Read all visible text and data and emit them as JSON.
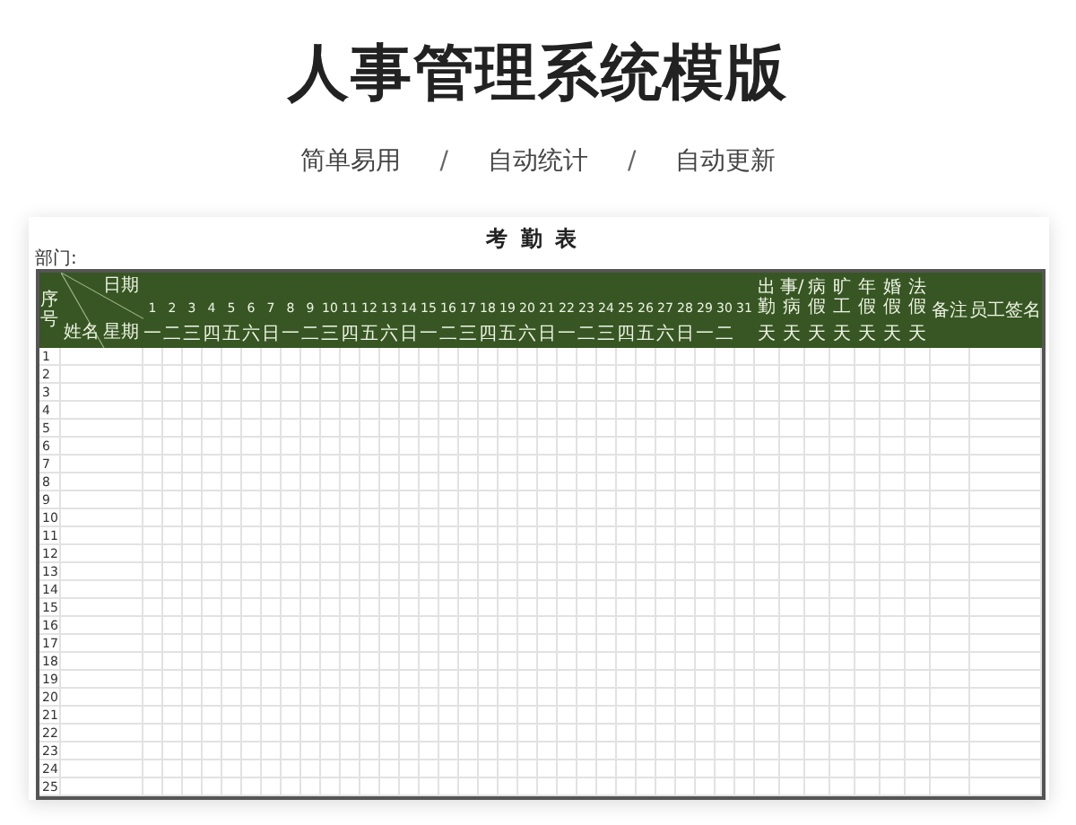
{
  "page_title": "人事管理系统模版",
  "taglines": [
    {
      "kind": "feature",
      "text": "简单易用"
    },
    {
      "kind": "separator",
      "text": "/"
    },
    {
      "kind": "feature",
      "text": "自动统计"
    },
    {
      "kind": "separator",
      "text": "/"
    },
    {
      "kind": "feature",
      "text": "自动更新"
    }
  ],
  "sheet": {
    "title": "考勤表",
    "department_label": "部门:",
    "header": {
      "index": "序号",
      "name": "姓名",
      "date": "日期",
      "weekday": "星期"
    },
    "days": [
      {
        "day": "1",
        "weekday": "一"
      },
      {
        "day": "2",
        "weekday": "二"
      },
      {
        "day": "3",
        "weekday": "三"
      },
      {
        "day": "4",
        "weekday": "四"
      },
      {
        "day": "5",
        "weekday": "五"
      },
      {
        "day": "6",
        "weekday": "六"
      },
      {
        "day": "7",
        "weekday": "日"
      },
      {
        "day": "8",
        "weekday": "一"
      },
      {
        "day": "9",
        "weekday": "二"
      },
      {
        "day": "10",
        "weekday": "三"
      },
      {
        "day": "11",
        "weekday": "四"
      },
      {
        "day": "12",
        "weekday": "五"
      },
      {
        "day": "13",
        "weekday": "六"
      },
      {
        "day": "14",
        "weekday": "日"
      },
      {
        "day": "15",
        "weekday": "一"
      },
      {
        "day": "16",
        "weekday": "二"
      },
      {
        "day": "17",
        "weekday": "三"
      },
      {
        "day": "18",
        "weekday": "四"
      },
      {
        "day": "19",
        "weekday": "五"
      },
      {
        "day": "20",
        "weekday": "六"
      },
      {
        "day": "21",
        "weekday": "日"
      },
      {
        "day": "22",
        "weekday": "一"
      },
      {
        "day": "23",
        "weekday": "二"
      },
      {
        "day": "24",
        "weekday": "三"
      },
      {
        "day": "25",
        "weekday": "四"
      },
      {
        "day": "26",
        "weekday": "五"
      },
      {
        "day": "27",
        "weekday": "六"
      },
      {
        "day": "28",
        "weekday": "日"
      },
      {
        "day": "29",
        "weekday": "一"
      },
      {
        "day": "30",
        "weekday": "二"
      },
      {
        "day": "31"
      }
    ],
    "tally_columns": [
      {
        "top": "出勤",
        "bottom": "天"
      },
      {
        "top": "事/病",
        "bottom": "天"
      },
      {
        "top": "病假",
        "bottom": "天"
      },
      {
        "top": "旷工",
        "bottom": "天"
      },
      {
        "top": "年假",
        "bottom": "天"
      },
      {
        "top": "婚假",
        "bottom": "天"
      },
      {
        "top": "法假",
        "bottom": "天"
      }
    ],
    "remark": "备注",
    "signature": "员工签名",
    "rows": [
      "1",
      "2",
      "3",
      "4",
      "5",
      "6",
      "7",
      "8",
      "9",
      "10",
      "11",
      "12",
      "13",
      "14",
      "15",
      "16",
      "17",
      "18",
      "19",
      "20",
      "21",
      "22",
      "23",
      "24",
      "25"
    ]
  }
}
